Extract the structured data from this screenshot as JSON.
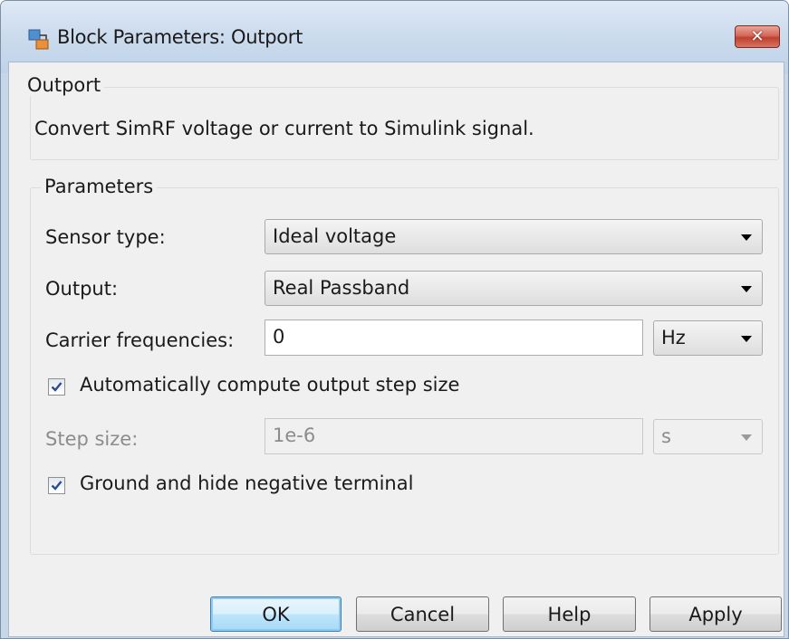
{
  "window": {
    "title": "Block Parameters: Outport"
  },
  "icons": {
    "app": "simulink-block-icon",
    "close": "close-icon",
    "dropdown": "chevron-down-icon",
    "check": "check-icon"
  },
  "colors": {
    "close_button": "#c94a39",
    "default_button_border": "#3c7fb1",
    "disabled_text": "#8c8c8c"
  },
  "outport_group": {
    "legend": "Outport",
    "description": "Convert SimRF voltage or current to Simulink signal."
  },
  "parameters_group": {
    "legend": "Parameters",
    "sensor_type": {
      "label": "Sensor type:",
      "value": "Ideal voltage"
    },
    "output": {
      "label": "Output:",
      "value": "Real Passband"
    },
    "carrier_frequencies": {
      "label": "Carrier frequencies:",
      "value": "0",
      "unit": "Hz"
    },
    "auto_step": {
      "label": "Automatically compute output step size",
      "checked": true
    },
    "step_size": {
      "label": "Step size:",
      "value": "1e-6",
      "unit": "s",
      "enabled": false
    },
    "ground_hide": {
      "label": "Ground and hide negative terminal",
      "checked": true
    }
  },
  "buttons": {
    "ok": "OK",
    "cancel": "Cancel",
    "help": "Help",
    "apply": "Apply"
  }
}
